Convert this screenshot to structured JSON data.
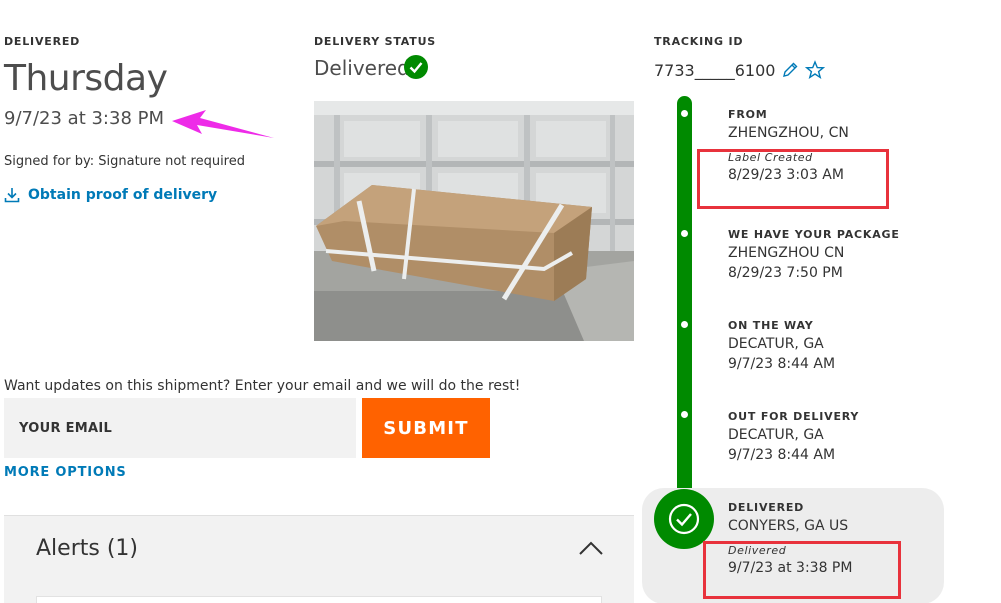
{
  "delivered_section": {
    "label": "DELIVERED",
    "day": "Thursday",
    "datetime": "9/7/23 at 3:38 PM",
    "signed_text": "Signed for by: Signature not required",
    "proof_link": "Obtain proof of delivery"
  },
  "delivery_status": {
    "label": "DELIVERY STATUS",
    "value": "Delivered"
  },
  "tracking": {
    "label": "TRACKING ID",
    "number": "7733_____6100"
  },
  "updates": {
    "prompt": "Want updates on this shipment? Enter your email and we will do the rest!",
    "email_placeholder": "YOUR EMAIL",
    "submit_label": "SUBMIT",
    "more_options": "MORE OPTIONS"
  },
  "alerts": {
    "title": "Alerts (1)"
  },
  "timeline": [
    {
      "title": "FROM",
      "location": "ZHENGZHOU, CN",
      "note": "Label Created",
      "time": "8/29/23 3:03 AM"
    },
    {
      "title": "WE HAVE YOUR PACKAGE",
      "location": "ZHENGZHOU CN",
      "time": "8/29/23 7:50 PM"
    },
    {
      "title": "ON THE WAY",
      "location": "DECATUR, GA",
      "time": "9/7/23 8:44 AM"
    },
    {
      "title": "OUT FOR DELIVERY",
      "location": "DECATUR, GA",
      "time": "9/7/23 8:44 AM"
    },
    {
      "title": "DELIVERED",
      "location": "CONYERS, GA US",
      "note": "Delivered",
      "time": "9/7/23 at 3:38 PM"
    }
  ],
  "colors": {
    "accent_blue": "#007ab7",
    "submit_orange": "#ff6200",
    "timeline_green": "#008a00",
    "highlight_red": "#e8323c",
    "annotation_magenta": "#ee2be8"
  }
}
